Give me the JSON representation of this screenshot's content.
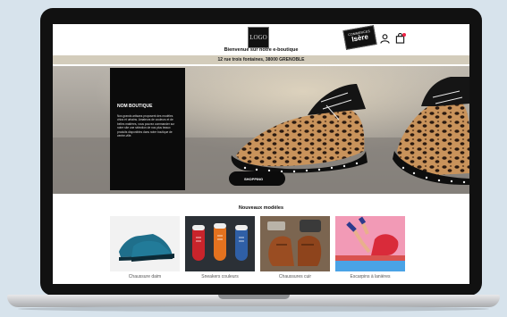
{
  "header": {
    "logo_text": "LOGO",
    "welcome": "Bienvenue sur notre e-boutique",
    "badge_line1": "COMMERCES",
    "badge_line2": "Isère"
  },
  "address": "12 rue trois fontaines, 38000 GRENOBLE",
  "hero": {
    "shop_title": "NOM BOUTIQUE",
    "shop_description": "Nos grands artisans proposent des modèles chics et urbains. Amateurs de couleurs et de belles matières, vous pouvez commander sur notre site une sélection de nos plus beaux produits disponibles dans notre boutique de centre-ville.",
    "button_label": "SHOPPING"
  },
  "new_models": {
    "title": "Nouveaux modèles",
    "items": [
      {
        "label": "Chaussure daim"
      },
      {
        "label": "Sneakers couleurs"
      },
      {
        "label": "Chaussures cuir"
      },
      {
        "label": "Escarpins à lanières"
      }
    ]
  },
  "colors": {
    "accent_bar": "#d3ccbb",
    "dark": "#0b0b0b",
    "suede_blue": "#1f6f8b"
  }
}
